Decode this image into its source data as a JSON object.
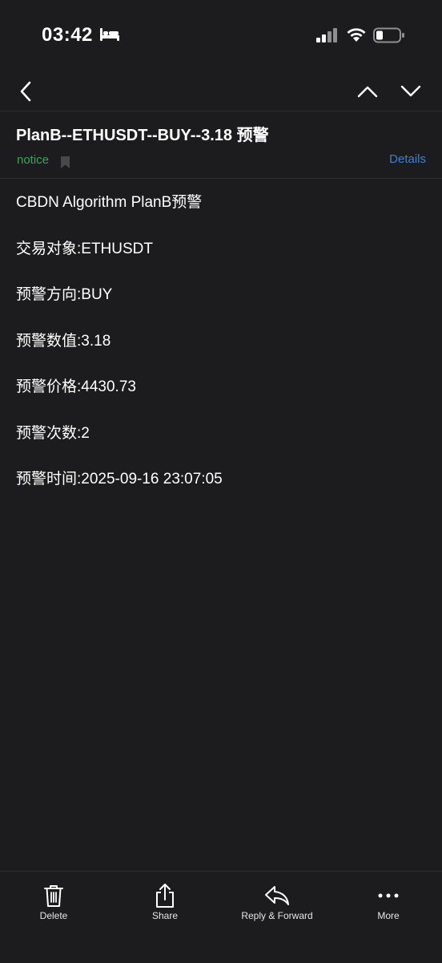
{
  "status_bar": {
    "time": "03:42"
  },
  "email": {
    "subject": "PlanB--ETHUSDT--BUY--3.18 预警",
    "tag": "notice",
    "details_label": "Details",
    "body_lines": [
      "CBDN Algorithm PlanB预警",
      "交易对象:ETHUSDT",
      "预警方向:BUY",
      "预警数值:3.18",
      "预警价格:4430.73",
      "预警次数:2",
      "预警时间:2025-09-16 23:07:05"
    ]
  },
  "toolbar": {
    "delete_label": "Delete",
    "share_label": "Share",
    "reply_label": "Reply & Forward",
    "more_label": "More"
  },
  "colors": {
    "background": "#1c1c1e",
    "tag_green": "#34a853",
    "link_blue": "#3f7fd0"
  }
}
